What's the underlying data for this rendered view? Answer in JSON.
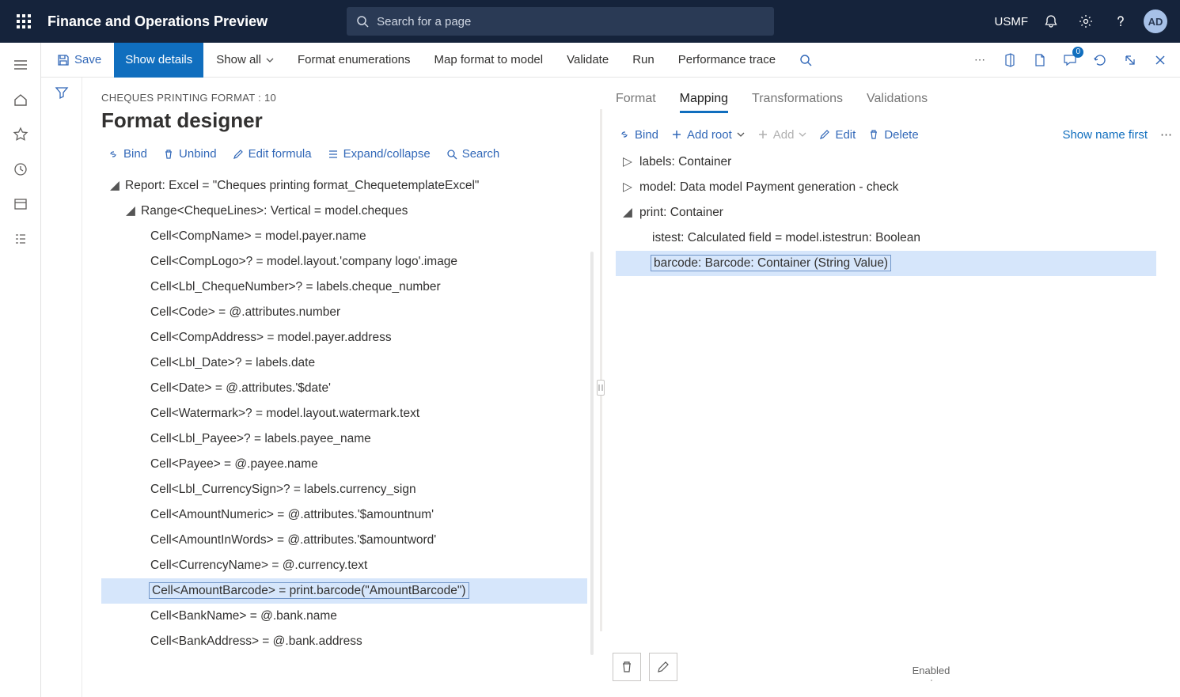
{
  "topbar": {
    "title": "Finance and Operations Preview",
    "search_placeholder": "Search for a page",
    "company": "USMF",
    "avatar": "AD"
  },
  "cmdbar": {
    "save": "Save",
    "show_details": "Show details",
    "show_all": "Show all",
    "format_enum": "Format enumerations",
    "map_format": "Map format to model",
    "validate": "Validate",
    "run": "Run",
    "perf_trace": "Performance trace",
    "badge": "0"
  },
  "page": {
    "breadcrumb": "CHEQUES PRINTING FORMAT : 10",
    "title": "Format designer"
  },
  "toolbar1": {
    "bind": "Bind",
    "unbind": "Unbind",
    "edit_formula": "Edit formula",
    "expand": "Expand/collapse",
    "search": "Search"
  },
  "tree": {
    "root": "Report: Excel = \"Cheques printing format_ChequetemplateExcel\"",
    "range": "Range<ChequeLines>: Vertical = model.cheques",
    "cells": [
      "Cell<CompName> = model.payer.name",
      "Cell<CompLogo>? = model.layout.'company logo'.image",
      "Cell<Lbl_ChequeNumber>? = labels.cheque_number",
      "Cell<Code> = @.attributes.number",
      "Cell<CompAddress> = model.payer.address",
      "Cell<Lbl_Date>? = labels.date",
      "Cell<Date> = @.attributes.'$date'",
      "Cell<Watermark>? = model.layout.watermark.text",
      "Cell<Lbl_Payee>? = labels.payee_name",
      "Cell<Payee> = @.payee.name",
      "Cell<Lbl_CurrencySign>? = labels.currency_sign",
      "Cell<AmountNumeric> = @.attributes.'$amountnum'",
      "Cell<AmountInWords> = @.attributes.'$amountword'",
      "Cell<CurrencyName> = @.currency.text",
      "Cell<AmountBarcode> = print.barcode(\"AmountBarcode\")",
      "Cell<BankName> = @.bank.name",
      "Cell<BankAddress> = @.bank.address"
    ]
  },
  "tabs": {
    "format": "Format",
    "mapping": "Mapping",
    "transformations": "Transformations",
    "validations": "Validations"
  },
  "toolbar2": {
    "bind": "Bind",
    "add_root": "Add root",
    "add": "Add",
    "edit": "Edit",
    "delete": "Delete",
    "show_name": "Show name first"
  },
  "rtree": {
    "labels": "labels: Container",
    "model": "model: Data model Payment generation - check",
    "print": "print: Container",
    "istest": "istest: Calculated field = model.istestrun: Boolean",
    "barcode": "barcode: Barcode: Container (String Value)"
  },
  "footer": {
    "enabled": "Enabled"
  }
}
